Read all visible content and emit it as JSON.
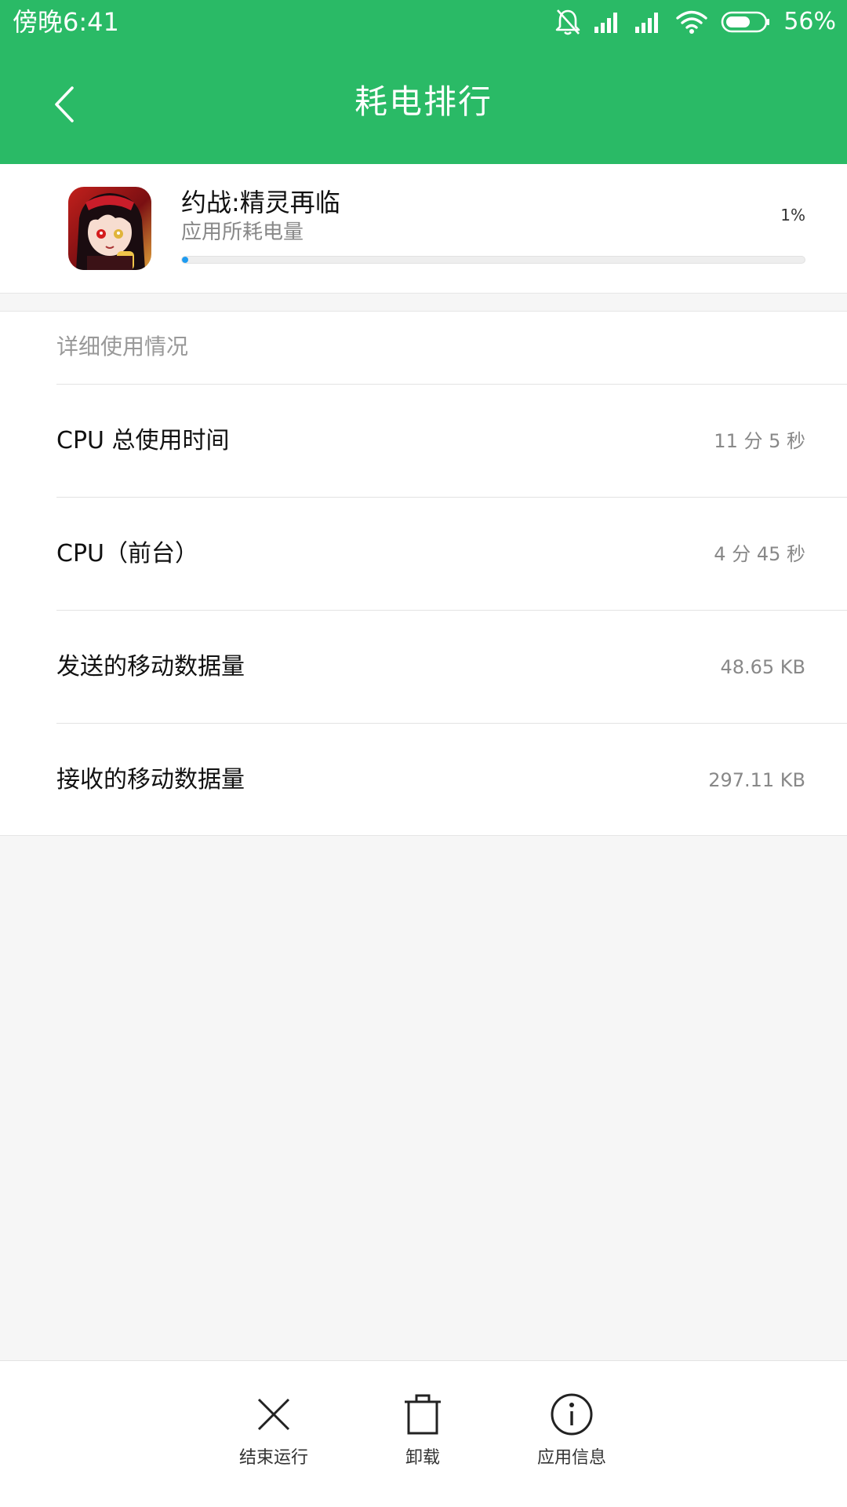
{
  "status_bar": {
    "time": "傍晚6:41",
    "battery_percent": "56%",
    "icons": [
      "bell-muted-icon",
      "signal-icon",
      "signal-icon",
      "wifi-icon",
      "battery-icon"
    ]
  },
  "header": {
    "title": "耗电排行",
    "back_icon": "back-chevron-icon",
    "color": "#2aba66"
  },
  "app": {
    "name": "约战:精灵再临",
    "subtitle": "应用所耗电量",
    "percent": "1%",
    "usage_fraction": 0.01,
    "bar_color": "#1e9bf0"
  },
  "details": {
    "section_title": "详细使用情况",
    "rows": [
      {
        "label": "CPU 总使用时间",
        "value": "11 分 5 秒"
      },
      {
        "label": "CPU（前台）",
        "value": "4 分 45 秒"
      },
      {
        "label": "发送的移动数据量",
        "value": "48.65 KB"
      },
      {
        "label": "接收的移动数据量",
        "value": "297.11 KB"
      }
    ]
  },
  "actions": [
    {
      "label": "结束运行",
      "icon": "close-x-icon"
    },
    {
      "label": "卸载",
      "icon": "trash-icon"
    },
    {
      "label": "应用信息",
      "icon": "info-icon"
    }
  ]
}
